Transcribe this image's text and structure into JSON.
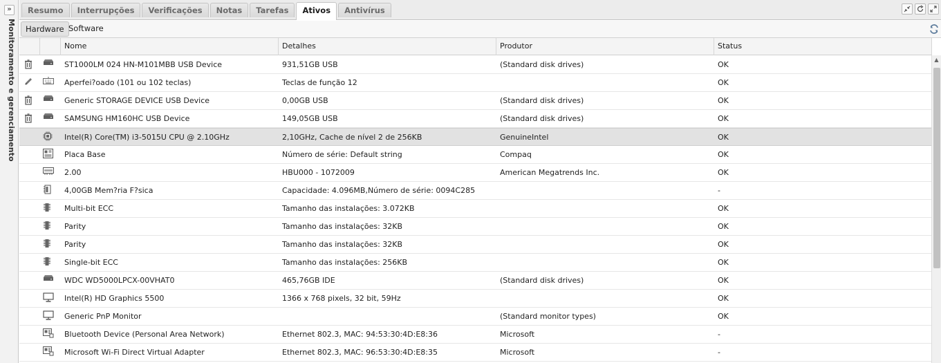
{
  "side_panel": {
    "label": "Monitoramento e gerenciamento",
    "expand_glyph": "»"
  },
  "tabs": [
    {
      "label": "Resumo",
      "active": false
    },
    {
      "label": "Interrupções",
      "active": false
    },
    {
      "label": "Verificações",
      "active": false
    },
    {
      "label": "Notas",
      "active": false
    },
    {
      "label": "Tarefas",
      "active": false
    },
    {
      "label": "Ativos",
      "active": true
    },
    {
      "label": "Antivírus",
      "active": false
    }
  ],
  "window_controls": [
    "collapse-icon",
    "restore-icon",
    "expand-icon"
  ],
  "subtabs": {
    "hardware": "Hardware",
    "software": "Software",
    "active": "Hardware"
  },
  "columns": {
    "nome": "Nome",
    "detalhes": "Detalhes",
    "produtor": "Produtor",
    "status": "Status"
  },
  "rows": [
    {
      "action": "trash-icon",
      "icon": "disk-drive-icon",
      "nome": "ST1000LM 024 HN-M101MBB USB Device",
      "detalhes": "931,51GB USB",
      "produtor": "(Standard disk drives)",
      "status": "OK"
    },
    {
      "action": "pencil-icon",
      "icon": "keyboard-icon",
      "nome": "Aperfei?oado (101 ou 102 teclas)",
      "detalhes": "Teclas de função 12",
      "produtor": "",
      "status": "OK"
    },
    {
      "action": "trash-icon",
      "icon": "disk-drive-icon",
      "nome": "Generic STORAGE DEVICE USB Device",
      "detalhes": "0,00GB USB",
      "produtor": "(Standard disk drives)",
      "status": "OK"
    },
    {
      "action": "trash-icon",
      "icon": "disk-drive-icon",
      "nome": "SAMSUNG HM160HC USB Device",
      "detalhes": "149,05GB USB",
      "produtor": "(Standard disk drives)",
      "status": "OK"
    },
    {
      "action": "",
      "icon": "cpu-icon",
      "nome": "Intel(R) Core(TM) i3-5015U CPU @ 2.10GHz",
      "detalhes": "2,10GHz, Cache de nível 2 de 256KB",
      "produtor": "GenuineIntel",
      "status": "OK",
      "selected": true
    },
    {
      "action": "",
      "icon": "motherboard-icon",
      "nome": "Placa Base",
      "detalhes": "Número de série: Default string",
      "produtor": "Compaq",
      "status": "OK"
    },
    {
      "action": "",
      "icon": "bios-icon",
      "nome": "2.00",
      "detalhes": "HBU000 - 1072009",
      "produtor": "American Megatrends Inc.",
      "status": "OK"
    },
    {
      "action": "",
      "icon": "memory-module-icon",
      "nome": "4,00GB Mem?ria F?sica",
      "detalhes": "Capacidade: 4.096MB,Número de série: 0094C285",
      "produtor": "",
      "status": "-"
    },
    {
      "action": "",
      "icon": "memory-chip-icon",
      "nome": "Multi-bit ECC",
      "detalhes": "Tamanho das instalações: 3.072KB",
      "produtor": "",
      "status": "OK"
    },
    {
      "action": "",
      "icon": "memory-chip-icon",
      "nome": "Parity",
      "detalhes": "Tamanho das instalações: 32KB",
      "produtor": "",
      "status": "OK"
    },
    {
      "action": "",
      "icon": "memory-chip-icon",
      "nome": "Parity",
      "detalhes": "Tamanho das instalações: 32KB",
      "produtor": "",
      "status": "OK"
    },
    {
      "action": "",
      "icon": "memory-chip-icon",
      "nome": "Single-bit ECC",
      "detalhes": "Tamanho das instalações: 256KB",
      "produtor": "",
      "status": "OK"
    },
    {
      "action": "",
      "icon": "disk-drive-icon",
      "nome": "WDC WD5000LPCX-00VHAT0",
      "detalhes": "465,76GB IDE",
      "produtor": "(Standard disk drives)",
      "status": "OK"
    },
    {
      "action": "",
      "icon": "monitor-icon",
      "nome": "Intel(R) HD Graphics 5500",
      "detalhes": "1366 x 768 pixels, 32 bit, 59Hz",
      "produtor": "",
      "status": "OK"
    },
    {
      "action": "",
      "icon": "monitor-icon",
      "nome": "Generic PnP Monitor",
      "detalhes": "",
      "produtor": "(Standard monitor types)",
      "status": "OK"
    },
    {
      "action": "",
      "icon": "network-adapter-icon",
      "nome": "Bluetooth Device (Personal Area Network)",
      "detalhes": "Ethernet 802.3, MAC: 94:53:30:4D:E8:36",
      "produtor": "Microsoft",
      "status": "-"
    },
    {
      "action": "",
      "icon": "network-adapter-icon",
      "nome": "Microsoft Wi-Fi Direct Virtual Adapter",
      "detalhes": "Ethernet 802.3, MAC: 96:53:30:4D:E8:35",
      "produtor": "Microsoft",
      "status": "-"
    }
  ]
}
